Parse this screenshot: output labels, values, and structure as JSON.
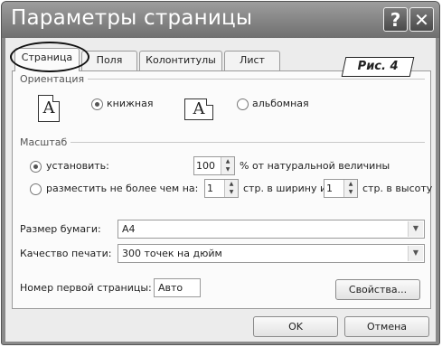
{
  "window": {
    "title": "Параметры страницы",
    "help_glyph": "?",
    "close_glyph": "✕"
  },
  "tabs": [
    {
      "label": "Страница"
    },
    {
      "label": "Поля"
    },
    {
      "label": "Колонтитулы"
    },
    {
      "label": "Лист"
    }
  ],
  "annotation": {
    "label": "Рис. 4"
  },
  "orientation": {
    "title": "Ориентация",
    "icon_glyph": "A",
    "portrait_label": "книжная",
    "landscape_label": "альбомная",
    "selected": "книжная"
  },
  "scale": {
    "title": "Масштаб",
    "set_label": "установить:",
    "set_value": "100",
    "set_suffix": "% от натуральной величины",
    "fit_label": "разместить не более чем на:",
    "fit_wide_value": "1",
    "fit_wide_suffix": "стр. в ширину и",
    "fit_tall_value": "1",
    "fit_tall_suffix": "стр. в высоту",
    "selected": "установить:"
  },
  "paper_size": {
    "label": "Размер бумаги:",
    "value": "A4"
  },
  "print_quality": {
    "label": "Качество печати:",
    "value": "300 точек на дюйм"
  },
  "first_page": {
    "label": "Номер первой страницы:",
    "value": "Авто"
  },
  "buttons": {
    "properties": "Свойства...",
    "ok": "OK",
    "cancel": "Отмена"
  },
  "icons": {
    "spin_up": "▲",
    "spin_down": "▼",
    "dropdown": "▼"
  }
}
